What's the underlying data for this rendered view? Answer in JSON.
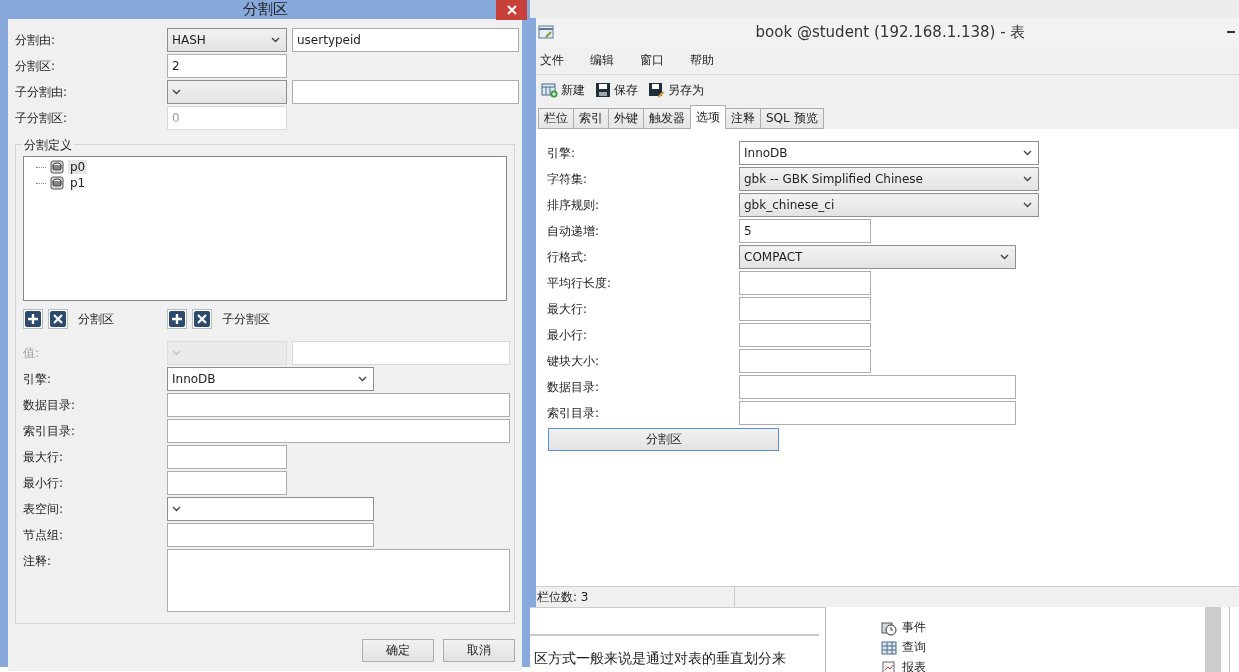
{
  "dialog": {
    "title": "分割区",
    "top_fields": [
      {
        "label": "分割由:",
        "kind": "select_pair",
        "value": "HASH",
        "value2": "usertypeid",
        "disabled": false
      },
      {
        "label": "分割区:",
        "kind": "short_input",
        "value": "2",
        "disabled": false
      },
      {
        "label": "子分割由:",
        "kind": "select_pair",
        "disabled": false
      },
      {
        "label": "子分割区:",
        "kind": "short_input",
        "value": "0",
        "disabled": true
      }
    ],
    "group_title": "分割定义",
    "partitions": [
      {
        "name": "p0",
        "selected": true
      },
      {
        "name": "p1",
        "selected": false
      }
    ],
    "partition_actions": [
      {
        "label": "分割区"
      },
      {
        "label": "子分割区"
      }
    ],
    "detail_fields": [
      {
        "label": "值:",
        "kind": "select_pair",
        "disabled": true
      },
      {
        "label": "引擎:",
        "kind": "select",
        "value": "InnoDB",
        "disabled": false
      },
      {
        "label": "数据目录:",
        "kind": "wide_input",
        "disabled": false
      },
      {
        "label": "索引目录:",
        "kind": "wide_input",
        "disabled": false
      },
      {
        "label": "最大行:",
        "kind": "short_input",
        "disabled": false
      },
      {
        "label": "最小行:",
        "kind": "short_input",
        "disabled": false
      },
      {
        "label": "表空间:",
        "kind": "select",
        "disabled": false
      },
      {
        "label": "节点组:",
        "kind": "input",
        "disabled": false
      },
      {
        "label": "注释:",
        "kind": "textarea",
        "disabled": false
      }
    ],
    "buttons": [
      "确定",
      "取消"
    ]
  },
  "main_window": {
    "title": "book @student (192.168.1.138) - 表",
    "menu": [
      "文件",
      "编辑",
      "窗口",
      "帮助"
    ],
    "toolbar": [
      {
        "label": "新建",
        "kind": "new"
      },
      {
        "label": "保存",
        "kind": "save"
      },
      {
        "label": "另存为",
        "kind": "save_as"
      }
    ],
    "tabs": [
      {
        "label": "栏位",
        "selected": false
      },
      {
        "label": "索引",
        "selected": false
      },
      {
        "label": "外键",
        "selected": false
      },
      {
        "label": "触发器",
        "selected": false
      },
      {
        "label": "选项",
        "selected": true
      },
      {
        "label": "注释",
        "selected": false
      },
      {
        "label": "SQL 预览",
        "selected": false
      }
    ],
    "options": [
      {
        "label": "引擎:",
        "kind": "select",
        "value": "InnoDB"
      },
      {
        "label": "字符集:",
        "kind": "select",
        "value": "gbk -- GBK Simplified Chinese"
      },
      {
        "label": "排序规则:",
        "kind": "select",
        "value": "gbk_chinese_ci"
      },
      {
        "label": "自动递增:",
        "kind": "short_input",
        "value": "5"
      },
      {
        "label": "行格式:",
        "kind": "mid_select",
        "value": "COMPACT"
      },
      {
        "label": "平均行长度:",
        "kind": "short_input"
      },
      {
        "label": "最大行:",
        "kind": "short_input"
      },
      {
        "label": "最小行:",
        "kind": "short_input"
      },
      {
        "label": "键块大小:",
        "kind": "short_input"
      },
      {
        "label": "数据目录:",
        "kind": "mid_input"
      },
      {
        "label": "索引目录:",
        "kind": "mid_input"
      }
    ],
    "partition_button": "分割区",
    "status": "栏位数: 3"
  },
  "background": {
    "article_text": "区方式一般来说是通过对表的垂直划分来",
    "tree": [
      {
        "label": "事件",
        "kind": "event"
      },
      {
        "label": "查询",
        "kind": "query"
      },
      {
        "label": "报表",
        "kind": "report"
      }
    ]
  }
}
